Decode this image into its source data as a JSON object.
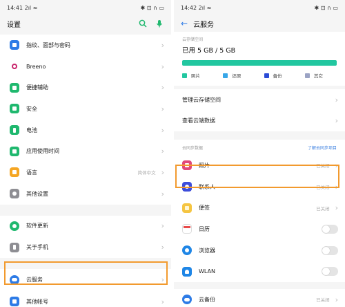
{
  "left": {
    "status": {
      "time": "14:41",
      "signal": "2ıl",
      "wifi": "≈",
      "right_icons": "✱ ⊡ ∩ ▭"
    },
    "title": "设置",
    "icons": {
      "search_color": "#1fb86e",
      "mic_color": "#1fb86e"
    },
    "groups": [
      [
        {
          "label": "指纹、面部与密码",
          "color": "#2d7be6",
          "icon": "fingerprint-icon"
        },
        {
          "label": "Breeno",
          "color": "#c8246b",
          "icon": "breeno-icon"
        },
        {
          "label": "便捷辅助",
          "color": "#1fb86e",
          "icon": "assist-icon"
        },
        {
          "label": "安全",
          "color": "#1fb86e",
          "icon": "shield-icon"
        },
        {
          "label": "电池",
          "color": "#1fb86e",
          "icon": "battery-icon"
        },
        {
          "label": "应用使用时间",
          "color": "#1fb86e",
          "icon": "hourglass-icon"
        },
        {
          "label": "语言",
          "value": "简体中文",
          "color": "#f5a623",
          "icon": "language-icon"
        },
        {
          "label": "其他设置",
          "color": "#8e8e93",
          "icon": "more-settings-icon"
        }
      ],
      [
        {
          "label": "软件更新",
          "color": "#1fb86e",
          "icon": "update-icon"
        },
        {
          "label": "关于手机",
          "color": "#8e8e93",
          "icon": "phone-info-icon"
        }
      ],
      [
        {
          "label": "云服务",
          "color": "#2d7be6",
          "icon": "cloud-icon"
        },
        {
          "label": "其他帐号",
          "color": "#2d7be6",
          "icon": "account-icon"
        }
      ]
    ]
  },
  "right": {
    "status": {
      "time": "14:42",
      "signal": "2ıl",
      "wifi": "≈",
      "right_icons": "✱ ⊡ ∩ ▭"
    },
    "back": "←",
    "title": "云服务",
    "storage": {
      "caption": "云存储空间",
      "used": "已用 5 GB / 5 GB",
      "bar_color": "#22c7a0",
      "legend": [
        {
          "label": "照片",
          "color": "#22c7a0"
        },
        {
          "label": "还原",
          "color": "#38a7e8"
        },
        {
          "label": "备份",
          "color": "#2b4bd6"
        },
        {
          "label": "其它",
          "color": "#9ba3c4"
        }
      ]
    },
    "manage": [
      {
        "label": "管理云存储空间"
      },
      {
        "label": "查看云端数据"
      }
    ],
    "section": {
      "title": "云同步数据",
      "link": "了解云同步项目"
    },
    "sync": [
      {
        "label": "照片",
        "value": "已关闭",
        "color": "#e2487a",
        "type": "chevron",
        "icon": "photos-icon"
      },
      {
        "label": "联系人",
        "value": "已关闭",
        "color": "#3d4ddb",
        "type": "chevron",
        "icon": "contacts-icon"
      },
      {
        "label": "便签",
        "value": "已关闭",
        "color": "#f5c542",
        "type": "chevron",
        "icon": "notes-icon"
      },
      {
        "label": "日历",
        "color": "#e84a4a",
        "type": "toggle",
        "icon": "calendar-icon"
      },
      {
        "label": "浏览器",
        "color": "#1f86e6",
        "type": "toggle",
        "icon": "browser-icon"
      },
      {
        "label": "WLAN",
        "color": "#1f86e6",
        "type": "toggle",
        "icon": "wlan-icon"
      }
    ],
    "backup": {
      "label": "云备份",
      "value": "已关闭",
      "color": "#2d7be6",
      "icon": "cloud-backup-icon"
    }
  },
  "highlight_color": "#f29a2e"
}
